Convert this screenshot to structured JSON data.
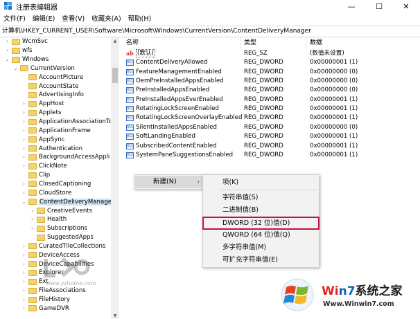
{
  "window": {
    "title": "注册表编辑器",
    "minimize_glyph": "—",
    "maximize_glyph": "☐",
    "close_glyph": "✕"
  },
  "menu": [
    "文件(F)",
    "编辑(E)",
    "查看(V)",
    "收藏夹(A)",
    "帮助(H)"
  ],
  "address": "计算机\\HKEY_CURRENT_USER\\Software\\Microsoft\\Windows\\CurrentVersion\\ContentDeliveryManager",
  "tree": {
    "expand_glyph": "›",
    "collapse_glyph": "⌄",
    "items": [
      {
        "label": "WcmSvc",
        "level": 1,
        "state": "collapsed"
      },
      {
        "label": "wfs",
        "level": 1,
        "state": "collapsed"
      },
      {
        "label": "Windows",
        "level": 1,
        "state": "expanded"
      },
      {
        "label": "CurrentVersion",
        "level": 2,
        "state": "expanded"
      },
      {
        "label": "AccountPicture",
        "level": 3,
        "state": "none"
      },
      {
        "label": "AccountState",
        "level": 3,
        "state": "none"
      },
      {
        "label": "AdvertisingInfo",
        "level": 3,
        "state": "none"
      },
      {
        "label": "AppHost",
        "level": 3,
        "state": "collapsed"
      },
      {
        "label": "Applets",
        "level": 3,
        "state": "collapsed"
      },
      {
        "label": "ApplicationAssociationTo",
        "level": 3,
        "state": "collapsed"
      },
      {
        "label": "ApplicationFrame",
        "level": 3,
        "state": "collapsed"
      },
      {
        "label": "AppSync",
        "level": 3,
        "state": "collapsed"
      },
      {
        "label": "Authentication",
        "level": 3,
        "state": "collapsed"
      },
      {
        "label": "BackgroundAccessAppli",
        "level": 3,
        "state": "collapsed"
      },
      {
        "label": "ClickNote",
        "level": 3,
        "state": "collapsed"
      },
      {
        "label": "Clip",
        "level": 3,
        "state": "none"
      },
      {
        "label": "ClosedCaptioning",
        "level": 3,
        "state": "collapsed"
      },
      {
        "label": "CloudStore",
        "level": 3,
        "state": "collapsed"
      },
      {
        "label": "ContentDeliveryManager",
        "level": 3,
        "state": "expanded",
        "selected": true
      },
      {
        "label": "CreativeEvents",
        "level": 4,
        "state": "collapsed"
      },
      {
        "label": "Health",
        "level": 4,
        "state": "collapsed"
      },
      {
        "label": "Subscriptions",
        "level": 4,
        "state": "collapsed"
      },
      {
        "label": "SuggestedApps",
        "level": 4,
        "state": "none"
      },
      {
        "label": "CuratedTileCollections",
        "level": 3,
        "state": "collapsed"
      },
      {
        "label": "DeviceAccess",
        "level": 3,
        "state": "collapsed"
      },
      {
        "label": "DeviceCapabilities",
        "level": 3,
        "state": "collapsed"
      },
      {
        "label": "Explorer",
        "level": 3,
        "state": "collapsed"
      },
      {
        "label": "Ext",
        "level": 3,
        "state": "collapsed"
      },
      {
        "label": "FileAssociations",
        "level": 3,
        "state": "collapsed"
      },
      {
        "label": "FileHistory",
        "level": 3,
        "state": "collapsed"
      },
      {
        "label": "GameDVR",
        "level": 3,
        "state": "collapsed"
      }
    ]
  },
  "columns": {
    "name": "名称",
    "type": "类型",
    "data": "数据"
  },
  "values": [
    {
      "name": "(默认)",
      "type": "REG_SZ",
      "data": "(数值未设置)",
      "icon": "ab"
    },
    {
      "name": "ContentDeliveryAllowed",
      "type": "REG_DWORD",
      "data": "0x00000001 (1)",
      "icon": "bin"
    },
    {
      "name": "FeatureManagementEnabled",
      "type": "REG_DWORD",
      "data": "0x00000000 (0)",
      "icon": "bin"
    },
    {
      "name": "OemPreInstalledAppsEnabled",
      "type": "REG_DWORD",
      "data": "0x00000000 (0)",
      "icon": "bin"
    },
    {
      "name": "PreInstalledAppsEnabled",
      "type": "REG_DWORD",
      "data": "0x00000000 (0)",
      "icon": "bin"
    },
    {
      "name": "PreInstalledAppsEverEnabled",
      "type": "REG_DWORD",
      "data": "0x00000001 (1)",
      "icon": "bin"
    },
    {
      "name": "RotatingLockScreenEnabled",
      "type": "REG_DWORD",
      "data": "0x00000001 (1)",
      "icon": "bin"
    },
    {
      "name": "RotatingLockScreenOverlayEnabled",
      "type": "REG_DWORD",
      "data": "0x00000001 (1)",
      "icon": "bin"
    },
    {
      "name": "SilentInstalledAppsEnabled",
      "type": "REG_DWORD",
      "data": "0x00000000 (0)",
      "icon": "bin"
    },
    {
      "name": "SoftLandingEnabled",
      "type": "REG_DWORD",
      "data": "0x00000001 (1)",
      "icon": "bin"
    },
    {
      "name": "SubscribedContentEnabled",
      "type": "REG_DWORD",
      "data": "0x00000001 (1)",
      "icon": "bin"
    },
    {
      "name": "SystemPaneSuggestionsEnabled",
      "type": "REG_DWORD",
      "data": "0x00000001 (1)",
      "icon": "bin"
    }
  ],
  "context_menu": {
    "new_label": "新建(N)",
    "submenu_glyph": "›",
    "submenu": [
      {
        "label": "项(K)"
      },
      {
        "label": "字符串值(S)"
      },
      {
        "label": "二进制值(B)"
      },
      {
        "label": "DWORD (32 位)值(D)",
        "highlighted": true
      },
      {
        "label": "QWORD (64 位)值(Q)"
      },
      {
        "label": "多字符串值(M)"
      },
      {
        "label": "可扩充字符串值(E)"
      }
    ]
  },
  "watermark": {
    "left_url": "www.yzhome.com",
    "brand_w": "Wi",
    "brand_n": "n",
    "brand_7": "7",
    "brand_rest": "系统之家",
    "brand_url": "Www.Winwin7.com"
  },
  "colors": {
    "accent_highlight": "#c0143c",
    "selected_bg": "#cce4f7",
    "folder": "#f3d36b"
  }
}
